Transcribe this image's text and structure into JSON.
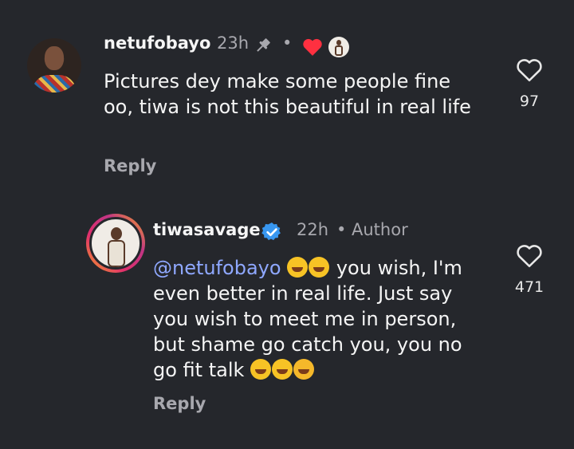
{
  "comments": [
    {
      "username": "netufobayo",
      "time": "23h",
      "separator": "•",
      "text": "Pictures dey make some people fine oo, tiwa is not this beautiful in real life",
      "reply_label": "Reply",
      "like_count": "97",
      "liked_by_author": true
    },
    {
      "username": "tiwasavage",
      "verified": true,
      "time": "22h",
      "separator": "•",
      "author_label": "Author",
      "mention": "@netufobayo",
      "text_after_mention": " you wish, I'm even better in real life. Just say you wish to meet me in person, but shame go catch you, you no go fit talk ",
      "reply_label": "Reply",
      "like_count": "471"
    }
  ],
  "colors": {
    "background": "#25272c",
    "mention": "#8fa8ff",
    "verified": "#3897f0",
    "heart": "#ff3040",
    "muted": "#a8a8ae"
  },
  "icons": [
    "pin-icon",
    "red-heart-icon",
    "heart-outline-icon",
    "verified-badge-icon",
    "rofl-emoji",
    "squinting-tongue-emoji",
    "kiss-emoji"
  ]
}
